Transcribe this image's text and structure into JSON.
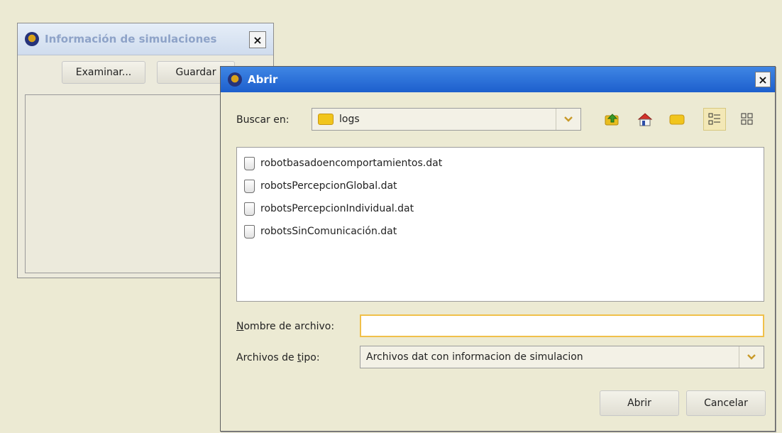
{
  "background_window": {
    "title": "Información de simulaciones",
    "close_label": "×",
    "buttons": {
      "examinar": "Examinar...",
      "guardar": "Guardar"
    }
  },
  "dialog": {
    "title": "Abrir",
    "close_label": "×",
    "look_in": {
      "label": "Buscar en:",
      "value": "logs"
    },
    "toolbar": [
      {
        "name": "up-one-level-icon"
      },
      {
        "name": "home-icon"
      },
      {
        "name": "new-folder-icon"
      },
      {
        "name": "list-view-icon",
        "selected": true
      },
      {
        "name": "details-view-icon"
      }
    ],
    "files": [
      "robotbasadoencomportamientos.dat",
      "robotsPercepcionGlobal.dat",
      "robotsPercepcionIndividual.dat",
      "robotsSinComunicación.dat"
    ],
    "file_name": {
      "label_mnemonic": "N",
      "label_rest": "ombre de archivo:",
      "value": ""
    },
    "file_type": {
      "label_pre": "Archivos de ",
      "label_mnemonic": "t",
      "label_post": "ipo:",
      "value": "Archivos dat con informacion de simulacion"
    },
    "buttons": {
      "open": "Abrir",
      "cancel": "Cancelar"
    }
  },
  "colors": {
    "dialog_titlebar": "#2a6fdb",
    "background": "#ecead3",
    "focus_border": "#f0c04a",
    "folder": "#f1c51c"
  }
}
